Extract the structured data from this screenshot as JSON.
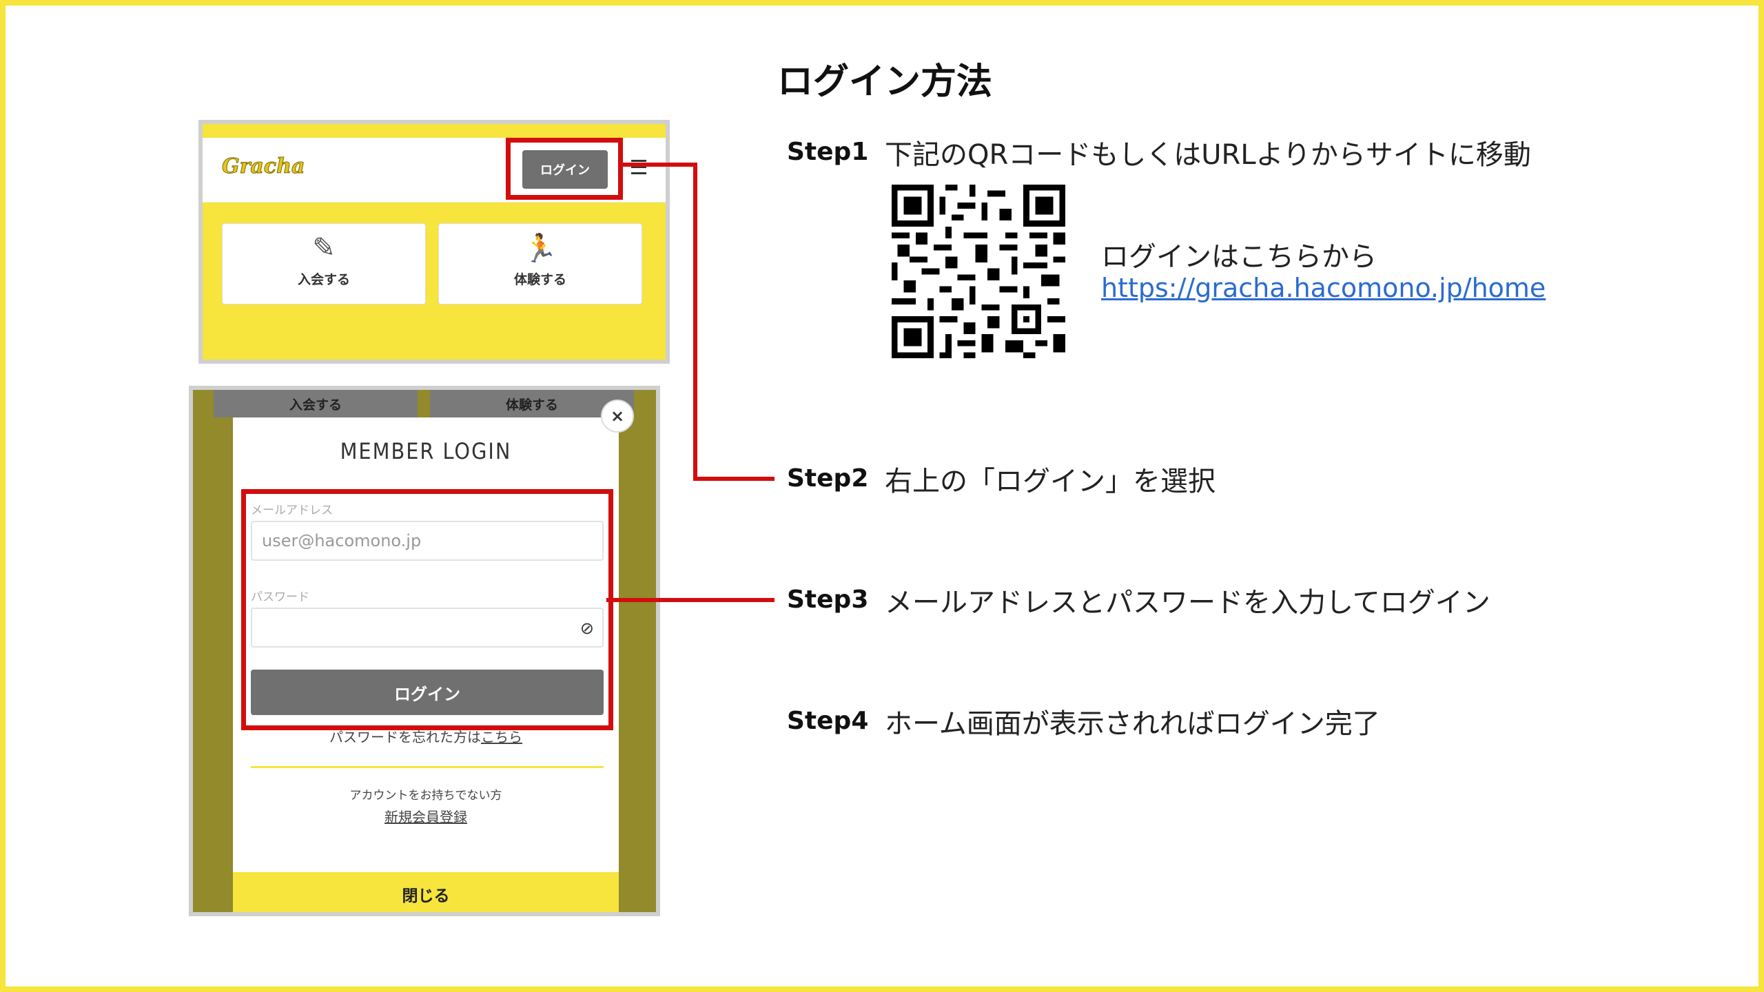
{
  "slide": {
    "title": "ログイン方法",
    "accent_color": "#f7e43c",
    "highlight_color": "#d30d0d"
  },
  "screenshot_top": {
    "logo_text": "Gracha",
    "login_button": "ログイン",
    "cards": [
      {
        "icon": "pencil-icon",
        "label": "入会する"
      },
      {
        "icon": "running-person-icon",
        "label": "体験する"
      }
    ]
  },
  "screenshot_modal": {
    "tabs_behind": [
      "入会する",
      "体験する"
    ],
    "title": "MEMBER LOGIN",
    "email_label": "メールアドレス",
    "email_placeholder": "user@hacomono.jp",
    "password_label": "パスワード",
    "login_button": "ログイン",
    "forgot_prefix": "パスワードを忘れた方は",
    "forgot_link": "こちら",
    "no_account": "アカウントをお持ちでない方",
    "register_link": "新規会員登録",
    "close_button": "閉じる",
    "close_icon": "×"
  },
  "steps": [
    {
      "key": "Step1",
      "text": "下記のQRコードもしくはURLよりからサイトに移動"
    },
    {
      "key": "Step2",
      "text": "右上の「ログイン」を選択"
    },
    {
      "key": "Step3",
      "text": "メールアドレスとパスワードを入力してログイン"
    },
    {
      "key": "Step4",
      "text": "ホーム画面が表示されればログイン完了"
    }
  ],
  "qr_section": {
    "prompt": "ログインはこちらから",
    "url": "https://gracha.hacomono.jp/home"
  }
}
